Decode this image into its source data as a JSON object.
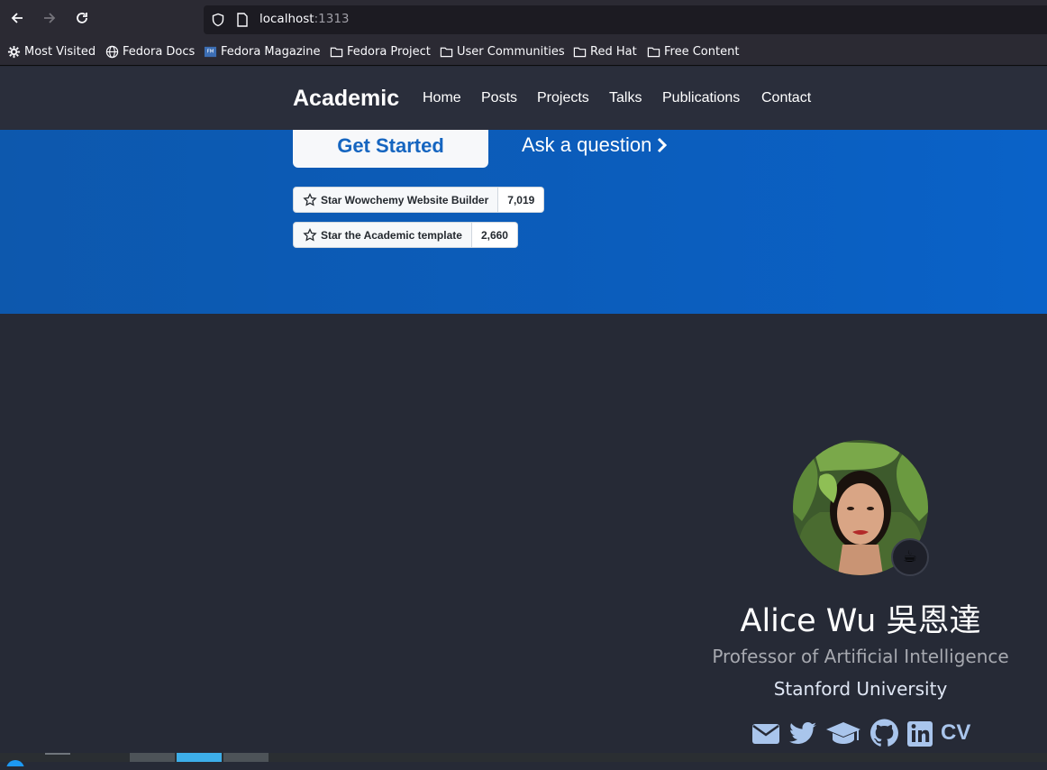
{
  "browser": {
    "url_host": "localhost",
    "url_port": ":1313",
    "bookmarks": [
      {
        "label": "Most Visited",
        "icon": "gear-icon"
      },
      {
        "label": "Fedora Docs",
        "icon": "globe-icon"
      },
      {
        "label": "Fedora Magazine",
        "icon": "fedora-magazine-icon"
      },
      {
        "label": "Fedora Project",
        "icon": "folder-icon"
      },
      {
        "label": "User Communities",
        "icon": "folder-icon"
      },
      {
        "label": "Red Hat",
        "icon": "folder-icon"
      },
      {
        "label": "Free Content",
        "icon": "folder-icon"
      }
    ]
  },
  "site": {
    "brand": "Academic",
    "nav": [
      "Home",
      "Posts",
      "Projects",
      "Talks",
      "Publications",
      "Contact"
    ]
  },
  "hero": {
    "get_started": "Get Started",
    "ask": "Ask a question",
    "github_buttons": [
      {
        "label": "Star Wowchemy Website Builder",
        "count": "7,019"
      },
      {
        "label": "Star the Academic template",
        "count": "2,660"
      }
    ]
  },
  "profile": {
    "status_emoji": "☕",
    "name": "Alice Wu 吳恩達",
    "role": "Professor of Artificial Intelligence",
    "organization": "Stanford University",
    "social": [
      "envelope-icon",
      "twitter-icon",
      "graduation-cap-icon",
      "github-icon",
      "linkedin-icon"
    ],
    "cv": "CV"
  },
  "colors": {
    "hero_blue": "#0b5dbc",
    "page_bg": "#262a36",
    "navbar_bg": "#2a2e3b",
    "social_icon": "#a9c5ec"
  }
}
